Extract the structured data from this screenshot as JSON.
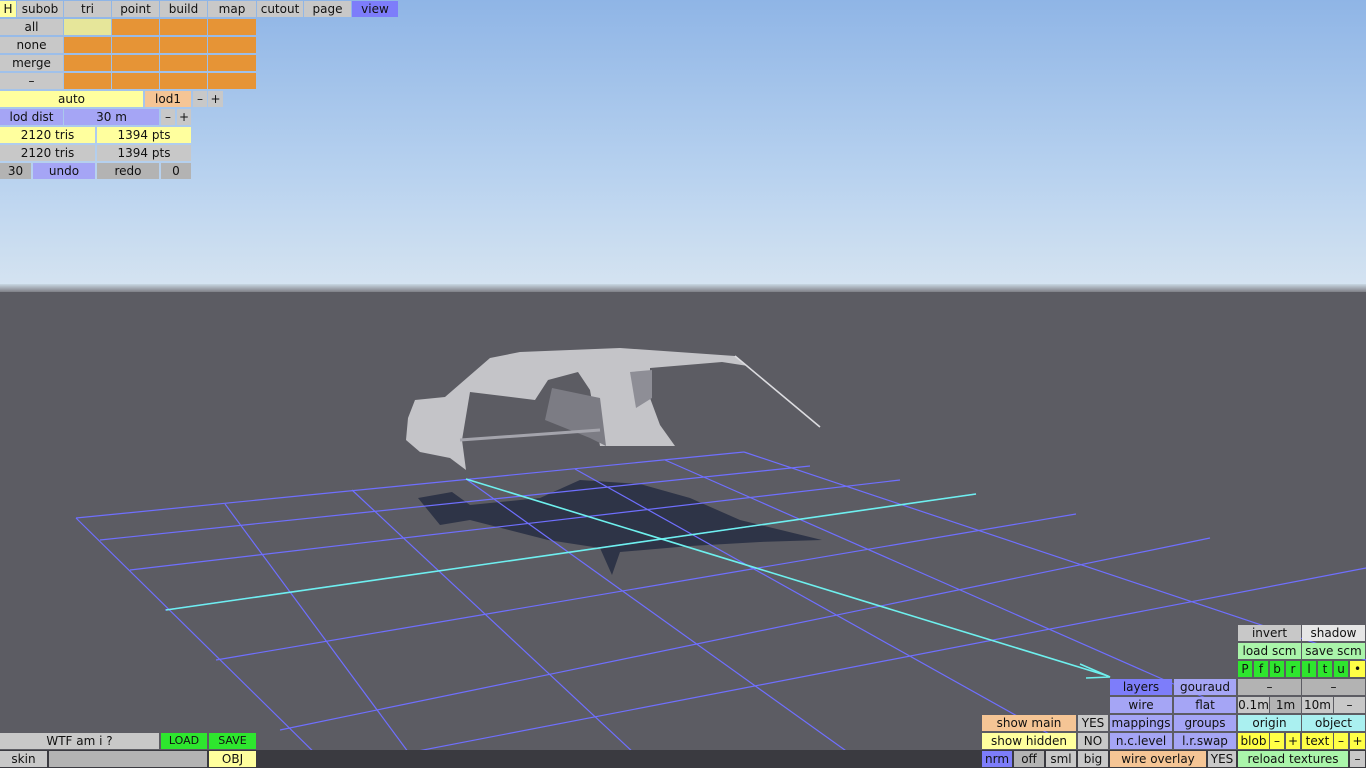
{
  "colors": {
    "sky_top": "#8fb5e6",
    "ground": "#5c5c63",
    "grid": "#6f6fff",
    "axis": "#6ef0ee",
    "model": "#c4c4c8",
    "shadow": "#2e3447"
  },
  "top_menu": {
    "h": "H",
    "items": [
      "subob",
      "tri",
      "point",
      "build",
      "map",
      "cutout",
      "page",
      "view"
    ]
  },
  "select": {
    "all": "all",
    "none": "none",
    "merge": "merge",
    "minus": "–"
  },
  "lod": {
    "auto": "auto",
    "lod1": "lod1",
    "minus": "–",
    "plus": "+",
    "dist_label": "lod dist",
    "dist_value": "30 m"
  },
  "stats": [
    {
      "tris": "2120 tris",
      "pts": "1394 pts"
    },
    {
      "tris": "2120 tris",
      "pts": "1394 pts"
    }
  ],
  "undo_row": {
    "count": "30",
    "undo": "undo",
    "redo": "redo",
    "redo_count": "0"
  },
  "bottom_left": {
    "title": "WTF am i ?",
    "load": "LOAD",
    "save": "SAVE",
    "skin": "skin",
    "obj": "OBJ"
  },
  "br": {
    "invert": "invert",
    "shadow": "shadow",
    "load_scm": "load scm",
    "save_scm": "save scm",
    "view_letters": [
      "P",
      "f",
      "b",
      "r",
      "l",
      "t",
      "u",
      "•"
    ],
    "layers": "layers",
    "gouraud": "gouraud",
    "dash": "–",
    "wire": "wire",
    "flat": "flat",
    "g01": "0.1m",
    "g1": "1m",
    "g10": "10m",
    "minus": "–",
    "show_main": "show main",
    "yes": "YES",
    "mappings": "mappings",
    "groups": "groups",
    "origin": "origin",
    "object": "object",
    "show_hidden": "show hidden",
    "no": "NO",
    "nclevel": "n.c.level",
    "lrswap": "l.r.swap",
    "blob": "blob",
    "plus": "+",
    "text": "text",
    "nrm": "nrm",
    "off": "off",
    "sml": "sml",
    "big": "big",
    "wire_overlay": "wire overlay",
    "reload": "reload textures"
  }
}
